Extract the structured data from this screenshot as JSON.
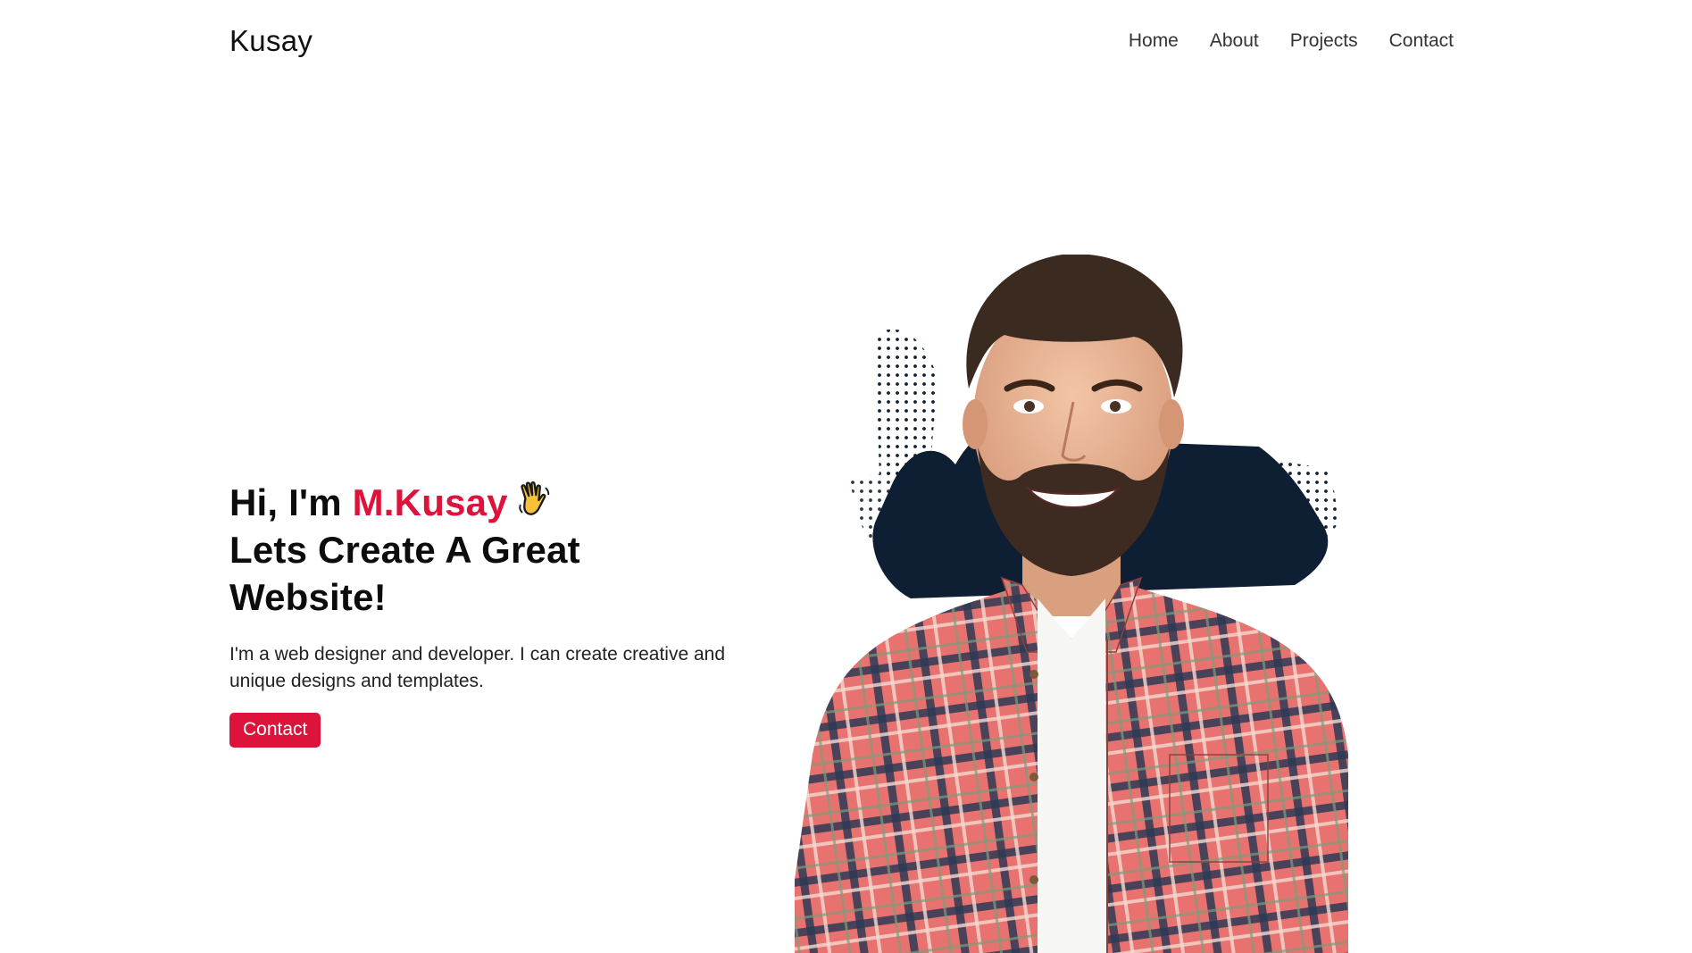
{
  "nav": {
    "brand": "Kusay",
    "links": [
      "Home",
      "About",
      "Projects",
      "Contact"
    ]
  },
  "hero": {
    "greeting_prefix": "Hi, I'm",
    "name": "M.Kusay",
    "line2": "Lets Create A Great",
    "line3": "Website!",
    "tagline": "I'm a web designer and developer. I can create creative and unique designs and templates.",
    "cta_label": "Contact",
    "icon": "waving-hand-icon"
  },
  "portrait": {
    "subject": "smiling bearded man in plaid shirt",
    "icon": "portrait-image"
  },
  "colors": {
    "accent": "#dc143c",
    "text": "#0c0c0c",
    "background": "#ffffff",
    "splash": "#0f1f33"
  }
}
